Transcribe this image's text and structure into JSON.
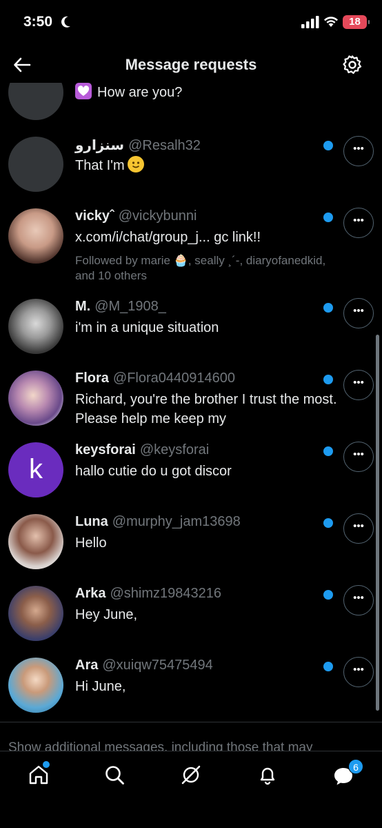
{
  "status_bar": {
    "time": "3:50",
    "battery": "18"
  },
  "header": {
    "title": "Message requests"
  },
  "conversations": [
    {
      "name": "",
      "handle": "",
      "message": "How are you?",
      "followed": ""
    },
    {
      "name": "سنزارو",
      "handle": "@Resalh32",
      "message": "That I'm",
      "followed": ""
    },
    {
      "name": "vickyˆ",
      "handle": "@vickybunni",
      "message": "x.com/i/chat/group_j... gc link!!",
      "followed": "Followed by marie 🧁, seally ¸´-, diaryofanedkid, and 10 others"
    },
    {
      "name": "M.",
      "handle": "@M_1908_",
      "message": "i'm in a unique situation",
      "followed": ""
    },
    {
      "name": "Flora",
      "handle": "@Flora0440914600",
      "message": "Richard, you're the brother  I trust the most. Please help me keep my",
      "followed": ""
    },
    {
      "name": "keysforai",
      "handle": "@keysforai",
      "message": "hallo cutie do u got discor",
      "followed": "",
      "avatar_letter": "k"
    },
    {
      "name": "Luna",
      "handle": "@murphy_jam13698",
      "message": "Hello",
      "followed": ""
    },
    {
      "name": "Arka",
      "handle": "@shimz19843216",
      "message": "Hey June,",
      "followed": ""
    },
    {
      "name": "Ara",
      "handle": "@xuiqw75475494",
      "message": "Hi June,",
      "followed": ""
    }
  ],
  "footer": {
    "more_text": "Show additional messages, including those that may"
  },
  "tabbar": {
    "messages_badge": "6"
  },
  "colors": {
    "accent": "#1d9bf0",
    "background": "#000000",
    "secondary_text": "#71767b"
  }
}
